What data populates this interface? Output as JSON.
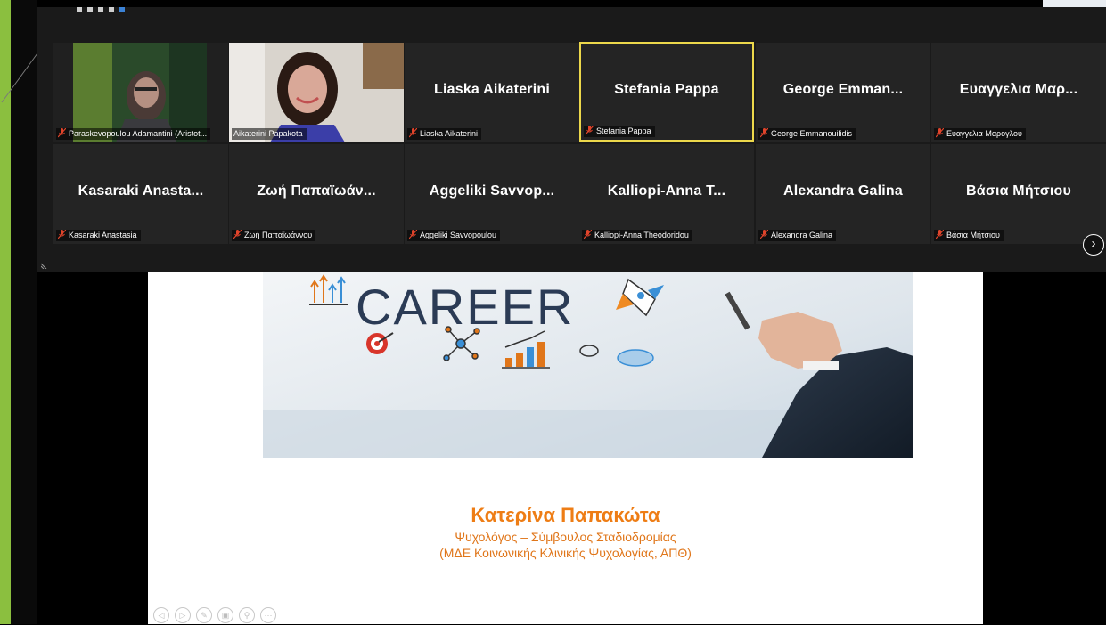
{
  "gallery": {
    "participants": [
      {
        "display": "",
        "caption": "Paraskevopoulou Adamantini (Aristot...",
        "video": true
      },
      {
        "display": "",
        "caption": "Aikaterini Papakota",
        "video": true
      },
      {
        "display": "Liaska Aikaterini",
        "caption": "Liaska Aikaterini",
        "video": false
      },
      {
        "display": "Stefania Pappa",
        "caption": "Stefania Pappa",
        "video": false
      },
      {
        "display": "George Emman...",
        "caption": "George Emmanouilidis",
        "video": false
      },
      {
        "display": "Ευαγγελια Μαρ...",
        "caption": "Ευαγγελια Μαρογλου",
        "video": false
      },
      {
        "display": "Kasaraki Anasta...",
        "caption": "Kasaraki Anastasia",
        "video": false
      },
      {
        "display": "Ζωή Παπαϊωάν...",
        "caption": "Ζωή Παπαϊωάννου",
        "video": false
      },
      {
        "display": "Aggeliki Savvop...",
        "caption": "Aggeliki Savvopoulou",
        "video": false
      },
      {
        "display": "Kalliopi-Anna T...",
        "caption": "Kalliopi-Anna Theodoridou",
        "video": false
      },
      {
        "display": "Alexandra Galina",
        "caption": "Alexandra Galina",
        "video": false
      },
      {
        "display": "Βάσια Μήτσιου",
        "caption": "Βάσια Μήτσιου",
        "video": false
      }
    ],
    "active_speaker": "Stefania Pappa",
    "next_page_icon": "chevron-right-icon",
    "mic_icon": "muted-mic-icon"
  },
  "slide": {
    "banner_word": "CAREER",
    "presenter_name": "Κατερίνα Παπακώτα",
    "presenter_role": "Ψυχολόγος – Σύμβουλος Σταδιοδρομίας",
    "presenter_degree": "(ΜΔΕ Κοινωνικής Κλινικής Ψυχολογίας, ΑΠΘ)",
    "controls": [
      "previous-icon",
      "next-icon",
      "pen-icon",
      "slides-icon",
      "zoom-icon",
      "more-icon"
    ]
  },
  "colors": {
    "accent_orange": "#ee7d15",
    "active_border": "#ecd84b",
    "muted_red": "#e0442b",
    "left_strip_green": "#8bbf3f"
  }
}
